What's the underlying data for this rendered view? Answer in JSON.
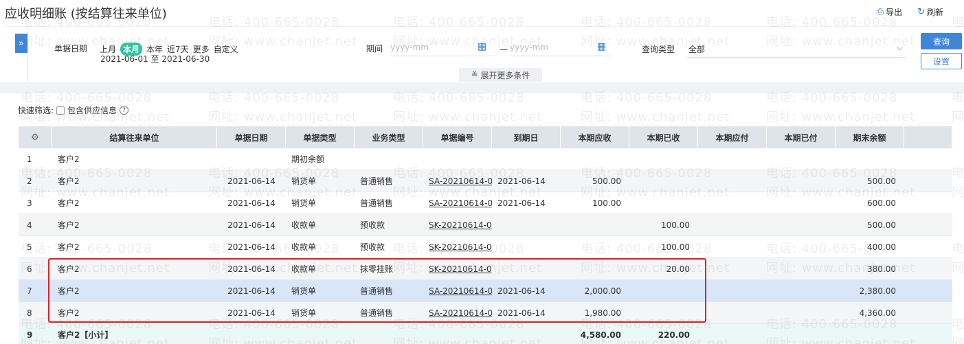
{
  "page": {
    "title": "应收明细账 (按结算往来单位)",
    "actions": [
      {
        "label": "导出",
        "icon": "export-icon"
      },
      {
        "label": "刷新",
        "icon": "refresh-icon"
      }
    ]
  },
  "watermark": {
    "phone": "电话: 400-665-0028",
    "site": "网址: www.chanjet.net"
  },
  "filters": {
    "date_label": "单据日期",
    "date_options": [
      "上月",
      "本月",
      "本年",
      "近7天",
      "更多",
      "自定义"
    ],
    "active_option": "本月",
    "date_range": "2021-06-01 至 2021-06-30",
    "period_label": "期间",
    "period_start_placeholder": "yyyy-mm",
    "period_sep": "—",
    "period_end_placeholder": "yyyy-mm",
    "query_type_label": "查询类型",
    "query_type_value": "全部",
    "query_button": "查询",
    "settings_button": "设置",
    "more_conditions": "展开更多条件"
  },
  "quick_filter": {
    "label": "快速筛选:",
    "checkbox_label": "包含供应信息",
    "checked": false
  },
  "table": {
    "columns": [
      "",
      "结算往来单位",
      "单据日期",
      "单据类型",
      "业务类型",
      "单据编号",
      "到期日",
      "本期应收",
      "本期已收",
      "本期应付",
      "本期已付",
      "期末余额",
      ""
    ],
    "rows": [
      {
        "idx": "1",
        "unit": "客户2",
        "date": "",
        "doc_type": "期初余额",
        "biz_type": "",
        "doc_no": "",
        "due": "",
        "recv": "",
        "received": "",
        "pay": "",
        "paid": "",
        "balance": ""
      },
      {
        "idx": "2",
        "unit": "客户2",
        "date": "2021-06-14",
        "doc_type": "销货单",
        "biz_type": "普通销售",
        "doc_no": "SA-20210614-0",
        "due": "2021-06-14",
        "recv": "500.00",
        "received": "",
        "pay": "",
        "paid": "",
        "balance": "500.00"
      },
      {
        "idx": "3",
        "unit": "客户2",
        "date": "2021-06-14",
        "doc_type": "销货单",
        "biz_type": "普通销售",
        "doc_no": "SA-20210614-0",
        "due": "2021-06-14",
        "recv": "100.00",
        "received": "",
        "pay": "",
        "paid": "",
        "balance": "600.00"
      },
      {
        "idx": "4",
        "unit": "客户2",
        "date": "2021-06-14",
        "doc_type": "收款单",
        "biz_type": "预收款",
        "doc_no": "SK-20210614-0",
        "due": "",
        "recv": "",
        "received": "100.00",
        "pay": "",
        "paid": "",
        "balance": "500.00"
      },
      {
        "idx": "5",
        "unit": "客户2",
        "date": "2021-06-14",
        "doc_type": "收款单",
        "biz_type": "预收款",
        "doc_no": "SK-20210614-0",
        "due": "",
        "recv": "",
        "received": "100.00",
        "pay": "",
        "paid": "",
        "balance": "400.00"
      },
      {
        "idx": "6",
        "unit": "客户2",
        "date": "2021-06-14",
        "doc_type": "收款单",
        "biz_type": "抹零挂账",
        "doc_no": "SK-20210614-0",
        "due": "",
        "recv": "",
        "received": "20.00",
        "pay": "",
        "paid": "",
        "balance": "380.00"
      },
      {
        "idx": "7",
        "unit": "客户2",
        "date": "2021-06-14",
        "doc_type": "销货单",
        "biz_type": "普通销售",
        "doc_no": "SA-20210614-0",
        "due": "2021-06-14",
        "recv": "2,000.00",
        "received": "",
        "pay": "",
        "paid": "",
        "balance": "2,380.00"
      },
      {
        "idx": "8",
        "unit": "客户2",
        "date": "2021-06-14",
        "doc_type": "销货单",
        "biz_type": "普通销售",
        "doc_no": "SA-20210614-0",
        "due": "2021-06-14",
        "recv": "1,980.00",
        "received": "",
        "pay": "",
        "paid": "",
        "balance": "4,360.00"
      },
      {
        "idx": "9",
        "unit": "客户2【小计】",
        "date": "",
        "doc_type": "",
        "biz_type": "",
        "doc_no": "",
        "due": "",
        "recv": "4,580.00",
        "received": "220.00",
        "pay": "",
        "paid": "",
        "balance": ""
      }
    ],
    "selected_row": 6,
    "subtotal_row": 8
  },
  "colors": {
    "accent": "#3f86db",
    "active_pill": "#2ec6a1",
    "highlight_box": "#e02020",
    "selected_row": "#d8e6f8",
    "subtotal_row": "#eaf8f8"
  }
}
